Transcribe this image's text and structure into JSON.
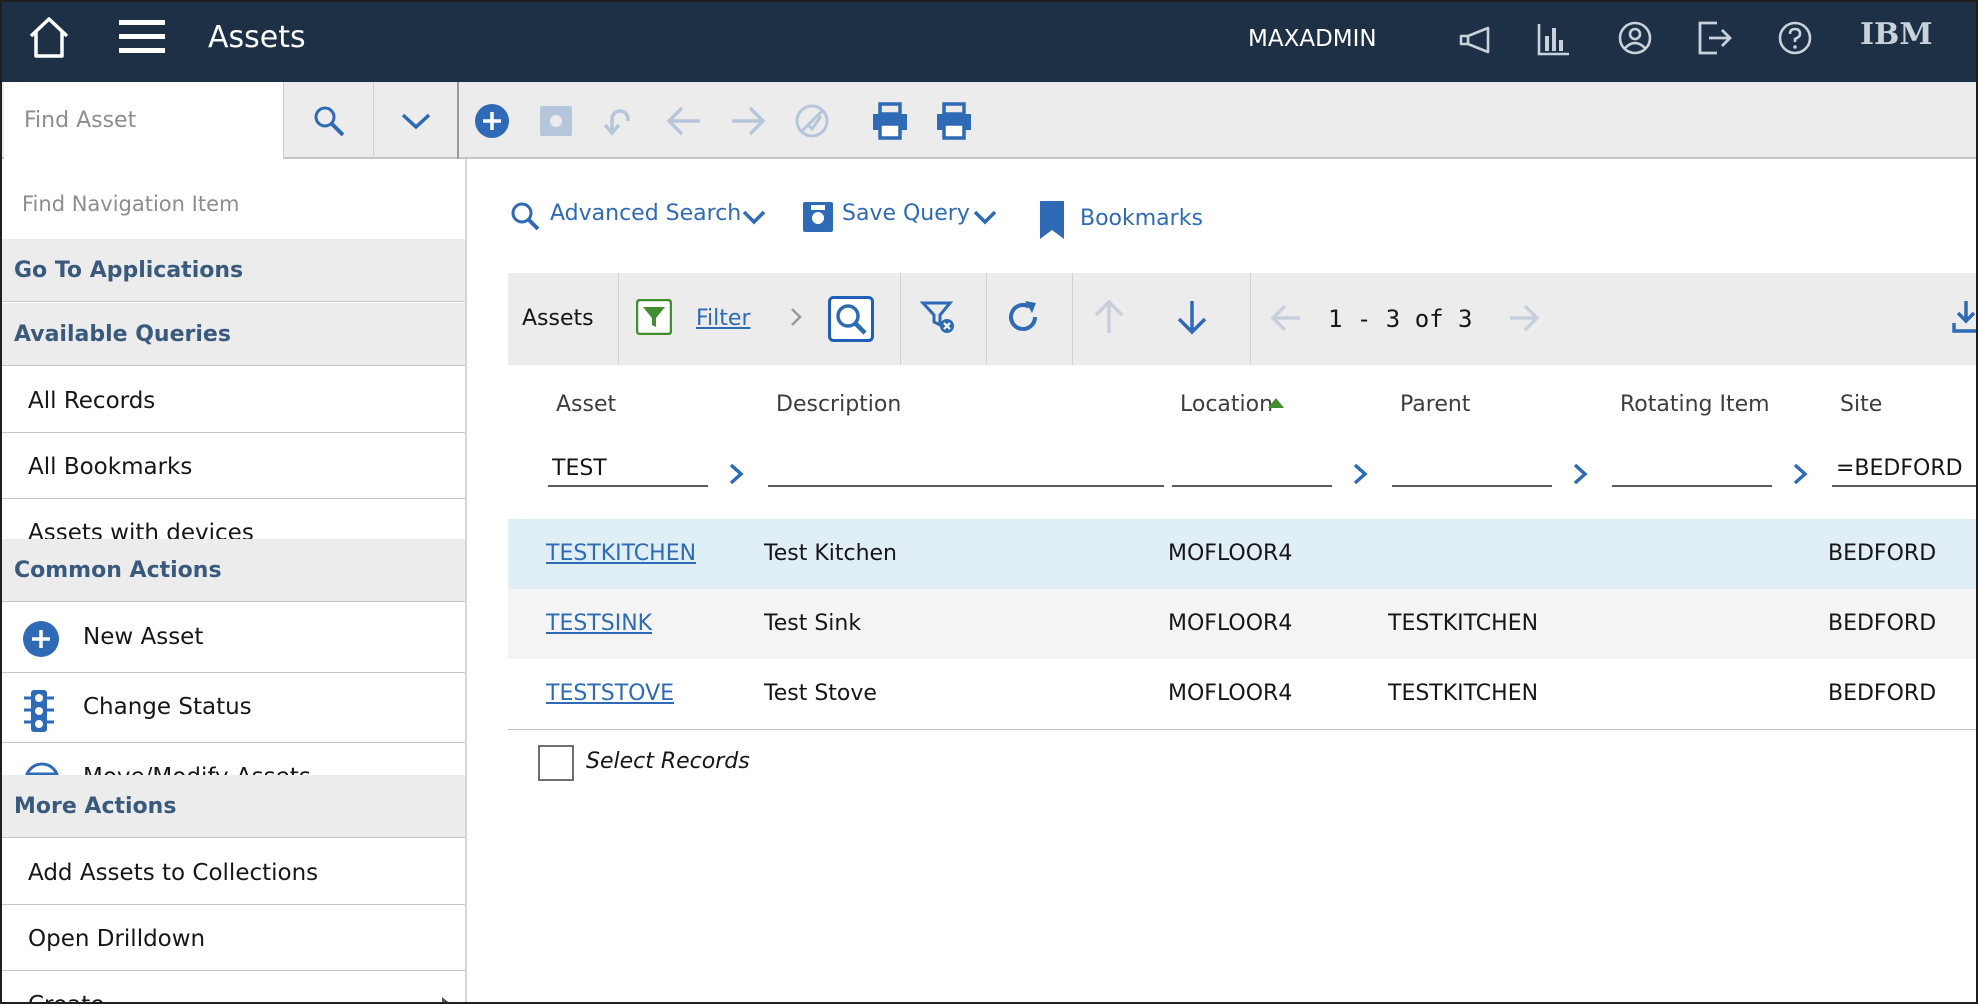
{
  "header": {
    "title": "Assets",
    "user": "MAXADMIN",
    "brand": "IBM"
  },
  "toolbar": {
    "find_placeholder": "Find Asset"
  },
  "sidebar": {
    "find_placeholder": "Find Navigation Item",
    "go_to_applications": "Go To Applications",
    "available_queries": {
      "title": "Available Queries",
      "items": [
        "All Records",
        "All Bookmarks",
        "Assets with devices"
      ]
    },
    "common_actions": {
      "title": "Common Actions",
      "items": [
        "New Asset",
        "Change Status",
        "Move/Modify Assets"
      ]
    },
    "more_actions": {
      "title": "More Actions",
      "items": [
        "Add Assets to Collections",
        "Open Drilldown",
        "Create"
      ]
    }
  },
  "search_bar": {
    "advanced_search": "Advanced Search",
    "save_query": "Save Query",
    "bookmarks": "Bookmarks"
  },
  "grid": {
    "title": "Assets",
    "filter_label": "Filter",
    "pagination": "1 - 3 of 3",
    "columns": [
      "Asset",
      "Description",
      "Location",
      "Parent",
      "Rotating Item",
      "Site"
    ],
    "filters": {
      "asset": "TEST",
      "description": "",
      "location": "",
      "parent": "",
      "rotating_item": "",
      "site": "=BEDFORD"
    },
    "rows": [
      {
        "asset": "TESTKITCHEN",
        "description": "Test Kitchen",
        "location": "MOFLOOR4",
        "parent": "",
        "rotating_item": "",
        "site": "BEDFORD"
      },
      {
        "asset": "TESTSINK",
        "description": "Test Sink",
        "location": "MOFLOOR4",
        "parent": "TESTKITCHEN",
        "rotating_item": "",
        "site": "BEDFORD"
      },
      {
        "asset": "TESTSTOVE",
        "description": "Test Stove",
        "location": "MOFLOOR4",
        "parent": "TESTKITCHEN",
        "rotating_item": "",
        "site": "BEDFORD"
      }
    ],
    "select_records": "Select Records"
  },
  "colors": {
    "header_bg": "#1e3046",
    "accent": "#2f6ab6",
    "selected_row": "#e0eef6",
    "section_text": "#3a5a7d",
    "filter_green": "#3f8f2e"
  },
  "icons": [
    "home-icon",
    "menu-icon",
    "announcement-icon",
    "reports-icon",
    "profile-icon",
    "logout-icon",
    "help-icon",
    "search-icon",
    "chevron-down-icon",
    "add-icon",
    "save-icon",
    "undo-icon",
    "arrow-left-icon",
    "arrow-right-icon",
    "status-icon",
    "print-icon",
    "bookmark-icon",
    "filter-icon",
    "clear-filter-icon",
    "refresh-icon",
    "arrow-up-icon",
    "arrow-down-icon",
    "download-icon",
    "traffic-light-icon",
    "move-modify-icon",
    "chevron-right-icon"
  ]
}
